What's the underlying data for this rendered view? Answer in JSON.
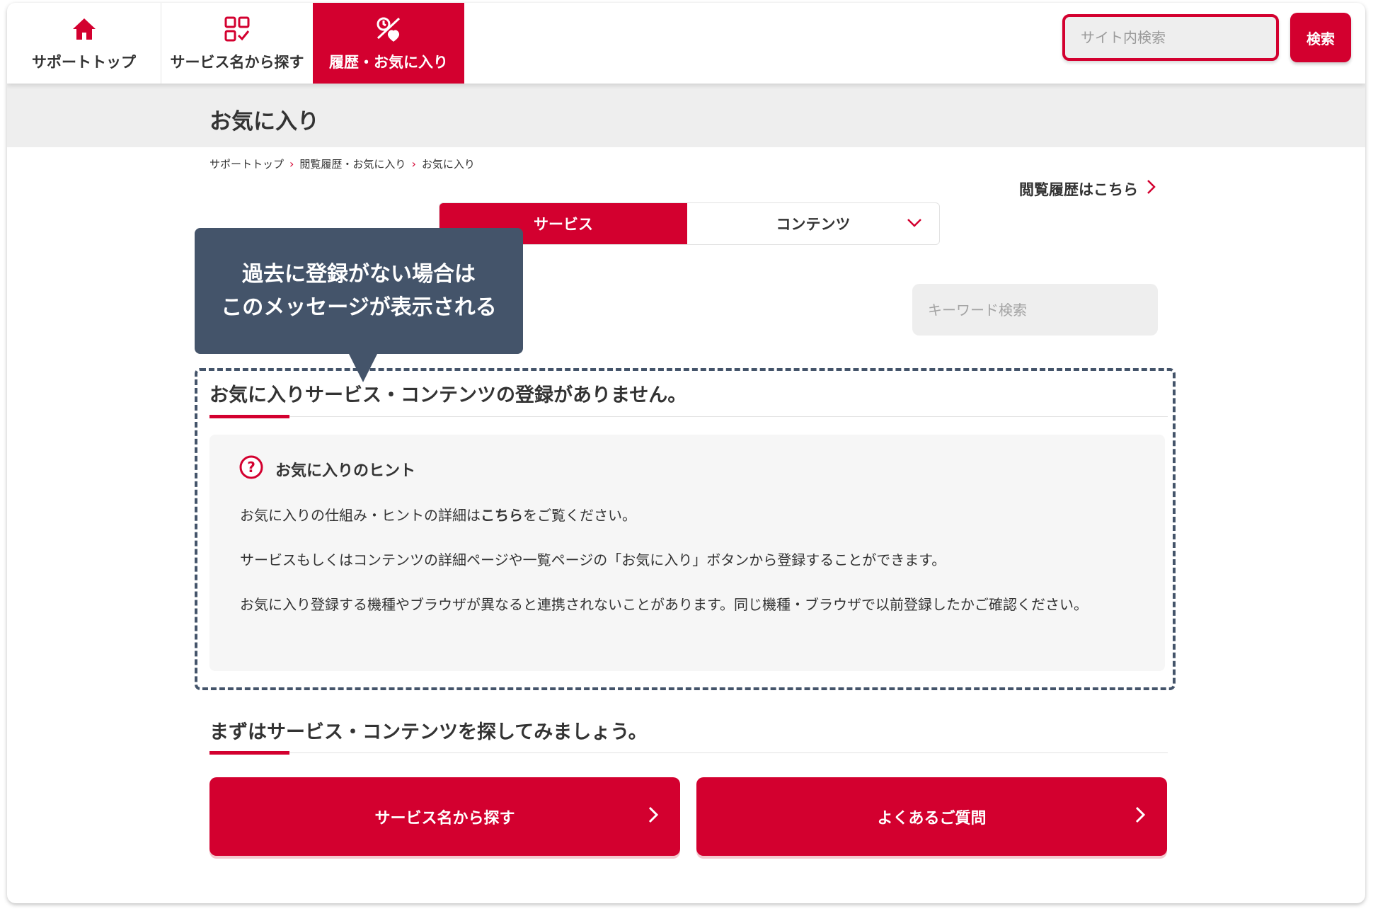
{
  "nav": {
    "items": [
      {
        "label": "サポートトップ",
        "icon": "home-icon"
      },
      {
        "label": "サービス名から探す",
        "icon": "grid-check-icon"
      },
      {
        "label": "履歴・お気に入り",
        "icon": "history-favorite-icon"
      }
    ],
    "search_placeholder": "サイト内検索",
    "search_button": "検索"
  },
  "page": {
    "title": "お気に入り",
    "breadcrumb": [
      "サポートトップ",
      "閲覧履歴・お気に入り",
      "お気に入り"
    ],
    "history_link": "閲覧履歴はこちら"
  },
  "tabs": {
    "active": "サービス",
    "inactive": "コンテンツ"
  },
  "keyword_placeholder": "キーワード検索",
  "tooltip": {
    "line1": "過去に登録がない場合は",
    "line2": "このメッセージが表示される"
  },
  "empty": {
    "heading": "お気に入りサービス・コンテンツの登録がありません。",
    "hint_title": "お気に入りのヒント",
    "p1_pre": "お気に入りの仕組み・ヒントの詳細は",
    "p1_link": "こちら",
    "p1_post": "をご覧ください。",
    "p2": "サービスもしくはコンテンツの詳細ページや一覧ページの「お気に入り」ボタンから登録することができます。",
    "p3": "お気に入り登録する機種やブラウザが異なると連携されないことがあります。同じ機種・ブラウザで以前登録したかご確認ください。"
  },
  "explore": {
    "heading": "まずはサービス・コンテンツを探してみましょう。",
    "btn_services": "サービス名から探す",
    "btn_faq": "よくあるご質問"
  },
  "colors": {
    "accent": "#d3002f",
    "tooltip": "#44546a"
  }
}
